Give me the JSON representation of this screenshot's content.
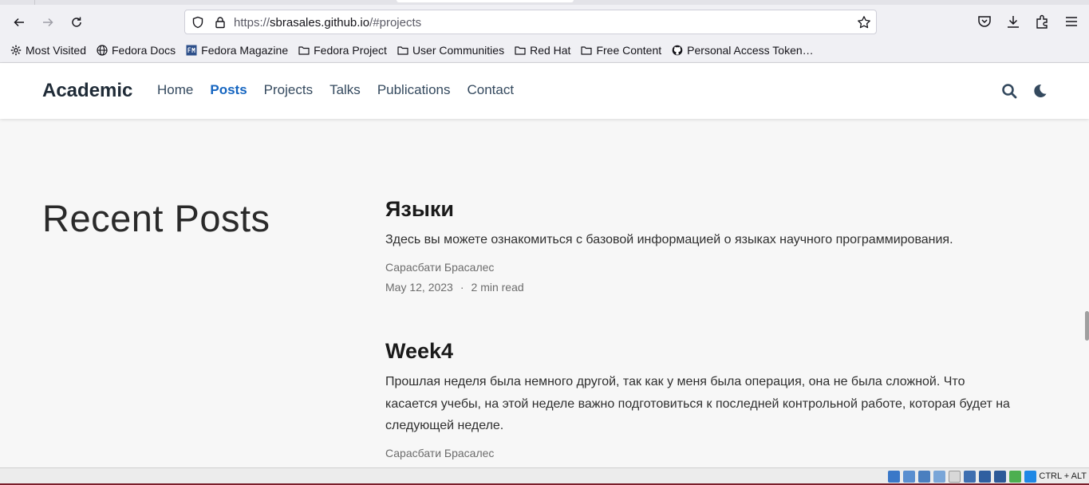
{
  "browser": {
    "url_prefix": "https://",
    "url_host": "sbrasales.github.io",
    "url_path": "/#projects",
    "bookmarks": [
      {
        "label": "Most Visited",
        "icon": "gear-icon"
      },
      {
        "label": "Fedora Docs",
        "icon": "globe-icon"
      },
      {
        "label": "Fedora Magazine",
        "icon": "fedora-magazine-icon"
      },
      {
        "label": "Fedora Project",
        "icon": "folder-icon"
      },
      {
        "label": "User Communities",
        "icon": "folder-icon"
      },
      {
        "label": "Red Hat",
        "icon": "folder-icon"
      },
      {
        "label": "Free Content",
        "icon": "folder-icon"
      },
      {
        "label": "Personal Access Token…",
        "icon": "github-icon"
      }
    ]
  },
  "site": {
    "brand": "Academic",
    "nav": [
      {
        "label": "Home",
        "active": false
      },
      {
        "label": "Posts",
        "active": true
      },
      {
        "label": "Projects",
        "active": false
      },
      {
        "label": "Talks",
        "active": false
      },
      {
        "label": "Publications",
        "active": false
      },
      {
        "label": "Contact",
        "active": false
      }
    ],
    "accent_color": "#1565c0"
  },
  "main": {
    "section_title": "Recent Posts",
    "posts": [
      {
        "title": "Языки",
        "summary": "Здесь вы можете ознакомиться с базовой информацией о языках научного программирования.",
        "author": "Сарасбати Брасалес",
        "date": "May 12, 2023",
        "separator": "·",
        "read_time": "2 min read"
      },
      {
        "title": "Week4",
        "summary": "Прошлая неделя была немного другой, так как у меня была операция, она не была сложной. Что касается учебы, на этой неделе важно подготовиться к последней контрольной работе, которая будет на следующей неделе.",
        "author": "Сарасбати Брасалес"
      }
    ]
  },
  "statusbar": {
    "keys": "CTRL + ALT"
  }
}
